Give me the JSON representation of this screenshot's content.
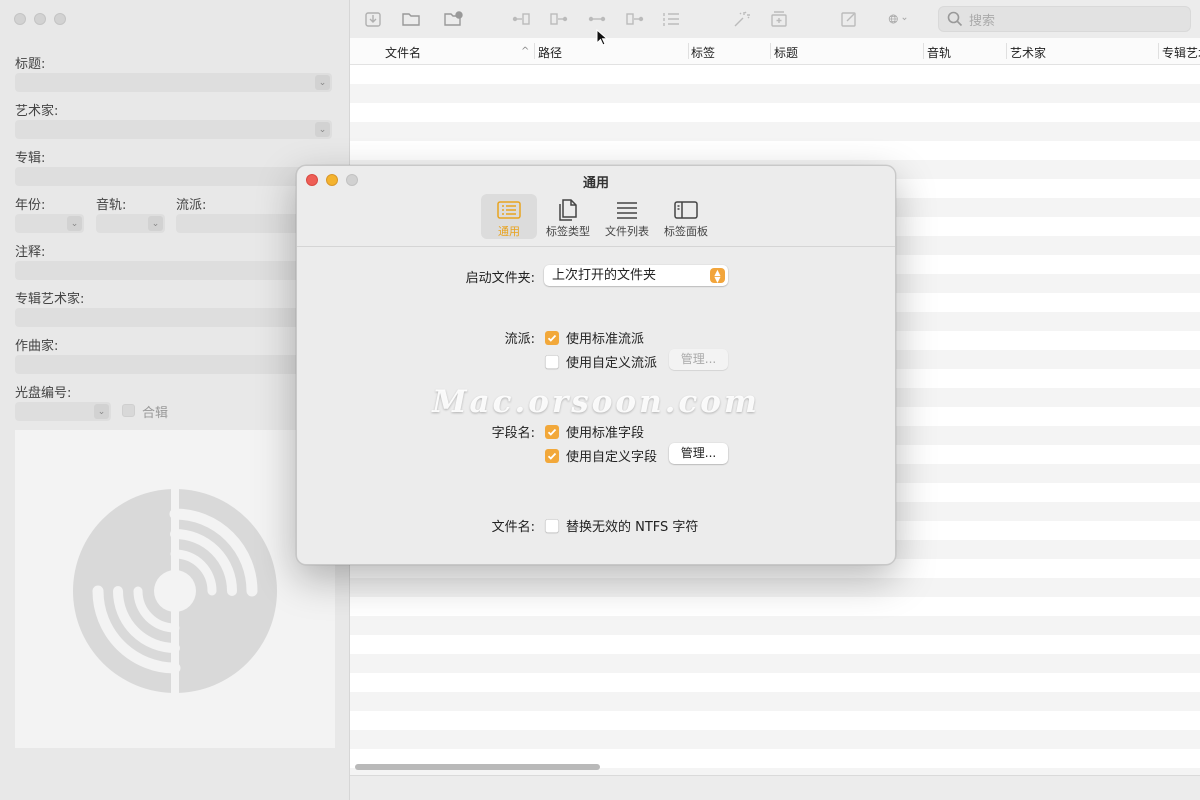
{
  "left_pane": {
    "fields": [
      {
        "label": "标题:"
      },
      {
        "label": "艺术家:"
      },
      {
        "label": "专辑:"
      },
      {
        "label": "年份:"
      },
      {
        "label": "音轨:"
      },
      {
        "label": "流派:"
      },
      {
        "label": "注释:"
      },
      {
        "label": "专辑艺术家:"
      },
      {
        "label": "作曲家:"
      },
      {
        "label": "光盘编号:"
      }
    ],
    "compilation_label": "合辑"
  },
  "toolbar": {
    "icons": [
      "import-icon",
      "folder-icon",
      "add-folder-icon",
      "tag-to-filename-icon",
      "filename-to-tag-icon",
      "tag-to-tag-icon",
      "text-to-tag-icon",
      "numbering-icon",
      "magic-wand-icon",
      "add-cover-icon",
      "edit-icon",
      "globe-icon"
    ],
    "search_placeholder": "搜索"
  },
  "table": {
    "columns": [
      "文件名",
      "路径",
      "标签",
      "标题",
      "音轨",
      "艺术家",
      "专辑艺术"
    ],
    "sort_indicator": "^"
  },
  "dialog": {
    "title": "通用",
    "tabs": [
      {
        "label": "通用",
        "icon": "list-panel-icon",
        "active": true
      },
      {
        "label": "标签类型",
        "icon": "documents-icon",
        "active": false
      },
      {
        "label": "文件列表",
        "icon": "lines-icon",
        "active": false
      },
      {
        "label": "标签面板",
        "icon": "sidebar-icon",
        "active": false
      }
    ],
    "startup_folder": {
      "label": "启动文件夹:",
      "value": "上次打开的文件夹"
    },
    "genre": {
      "label": "流派:",
      "standard": {
        "label": "使用标准流派",
        "checked": true
      },
      "custom": {
        "label": "使用自定义流派",
        "checked": false
      },
      "manage_label": "管理..."
    },
    "field_names": {
      "label": "字段名:",
      "standard": {
        "label": "使用标准字段",
        "checked": true
      },
      "custom": {
        "label": "使用自定义字段",
        "checked": true
      },
      "manage_label": "管理..."
    },
    "filename": {
      "label": "文件名:",
      "replace_ntfs": {
        "label": "替换无效的 NTFS 字符",
        "checked": false
      }
    }
  },
  "watermark": "Mac.orsoon.com",
  "colors": {
    "accent": "#f2a83a",
    "close": "#ee5e56",
    "minimize": "#f4b32e"
  }
}
